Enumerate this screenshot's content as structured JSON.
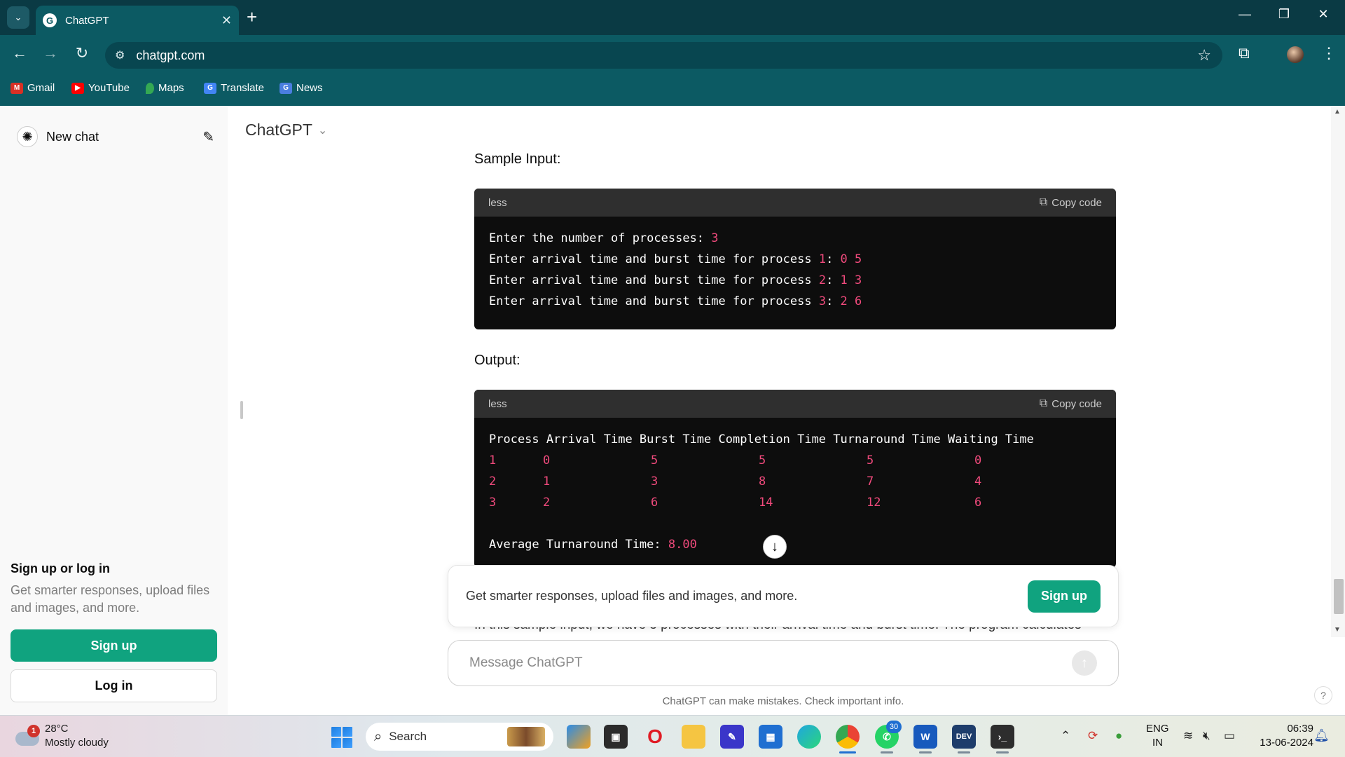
{
  "browser": {
    "tab_title": "ChatGPT",
    "tab_favicon": "G",
    "url": "chatgpt.com",
    "bookmarks": [
      {
        "label": "Gmail",
        "icon": "gmail-icon",
        "color": "#d93025"
      },
      {
        "label": "YouTube",
        "icon": "youtube-icon",
        "color": "#ff0000"
      },
      {
        "label": "Maps",
        "icon": "maps-icon",
        "color": "#34a853"
      },
      {
        "label": "Translate",
        "icon": "translate-icon",
        "color": "#4285f4"
      },
      {
        "label": "News",
        "icon": "news-icon",
        "color": "#4a7ee0"
      }
    ],
    "colors": {
      "titlebar": "#0a3a44",
      "toolbar": "#0c5a63"
    }
  },
  "sidebar": {
    "new_chat_label": "New chat",
    "signup_title": "Sign up or log in",
    "signup_desc": "Get smarter responses, upload files and images, and more.",
    "signup_button": "Sign up",
    "login_button": "Log in"
  },
  "main": {
    "model_title": "ChatGPT",
    "sample_input_label": "Sample Input:",
    "output_label": "Output:",
    "code_blocks": [
      {
        "language": "less",
        "copy_label": "Copy code",
        "lines": [
          {
            "text": "Enter the number of processes: ",
            "nums": "3"
          },
          {
            "text": "Enter arrival time and burst time for process ",
            "pnum": "1",
            "colon": ": ",
            "nums": "0 5"
          },
          {
            "text": "Enter arrival time and burst time for process ",
            "pnum": "2",
            "colon": ": ",
            "nums": "1 3"
          },
          {
            "text": "Enter arrival time and burst time for process ",
            "pnum": "3",
            "colon": ": ",
            "nums": "2 6"
          }
        ]
      },
      {
        "language": "less",
        "copy_label": "Copy code",
        "table_header": "Process Arrival Time Burst Time Completion Time Turnaround Time Waiting Time",
        "rows": [
          [
            "1",
            "0",
            "5",
            "5",
            "5",
            "0"
          ],
          [
            "2",
            "1",
            "3",
            "8",
            "7",
            "4"
          ],
          [
            "3",
            "2",
            "6",
            "14",
            "12",
            "6"
          ]
        ],
        "avg_label": "Average Turnaround Time: ",
        "avg_value": "8.00"
      }
    ],
    "partial_text": "In this sample input, we have 3 processes with their arrival time and burst time. The program calculates",
    "overlay_message": "Get smarter responses, upload files and images, and more.",
    "overlay_button": "Sign up",
    "composer_placeholder": "Message ChatGPT",
    "disclaimer": "ChatGPT can make mistakes. Check important info.",
    "help": "?",
    "colors": {
      "accent": "#10a37f",
      "code_number": "#f04a7c",
      "code_bg": "#0d0d0d"
    }
  },
  "taskbar": {
    "weather_badge": "1",
    "weather_temp": "28°C",
    "weather_desc": "Mostly cloudy",
    "search_label": "Search",
    "whatsapp_badge": "30",
    "lang_line1": "ENG",
    "lang_line2": "IN",
    "time": "06:39",
    "date": "13-06-2024"
  }
}
